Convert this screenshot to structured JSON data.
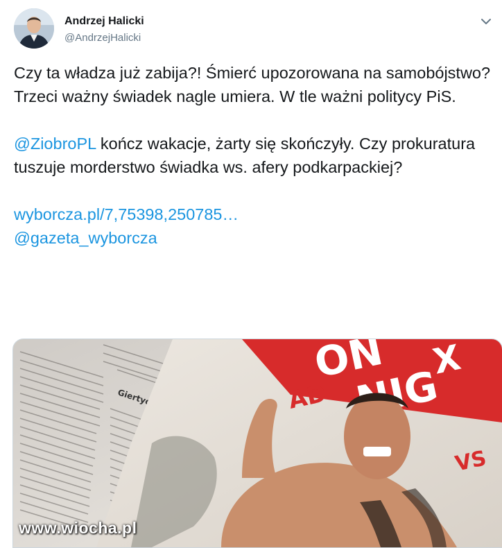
{
  "author": {
    "name": "Andrzej Halicki",
    "handle": "@AndrzejHalicki"
  },
  "tweet": {
    "paragraph1": "Czy ta władza już zabija?! Śmierć upozorowana na samobójstwo? Trzeci ważny świadek nagle umiera. W tle ważni politycy PiS.",
    "mention": "@ZiobroPL",
    "paragraph2_rest": " kończ wakacje, żarty się skończyły. Czy prokuratura tuszuje morderstwo świadka ws. afery podkarpackiej?",
    "link": "wyborcza.pl/7,75398,250785…",
    "mention2": "@gazeta_wyborcza"
  },
  "media": {
    "newspaper_headline": "Giertych: Potrzebna nowa sekcja zwłok",
    "tabloid_letters": [
      "ON",
      "NIG",
      "AD",
      "X",
      "VS"
    ],
    "watermark": "www.wiocha.pl"
  },
  "colors": {
    "link": "#1b95e0",
    "text": "#14171a",
    "muted": "#657786"
  }
}
